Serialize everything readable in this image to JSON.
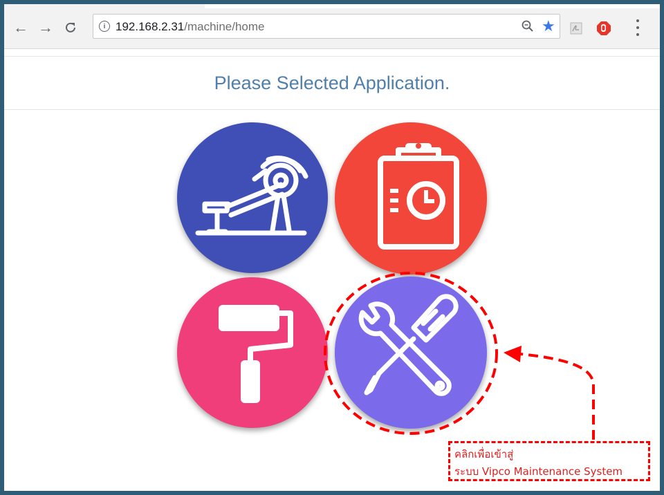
{
  "browser": {
    "url_host": "192.168.2.31",
    "url_path": "/machine/home",
    "colors": {
      "bookmark_star": "#3b78e7",
      "frame": "#2f5d78"
    }
  },
  "page": {
    "title": "Please Selected Application.",
    "title_color": "#4f7fac"
  },
  "apps": [
    {
      "icon": "machine-icon",
      "color": "#3f4fb5"
    },
    {
      "icon": "clipboard-clock-icon",
      "color": "#f2463a"
    },
    {
      "icon": "paint-roller-icon",
      "color": "#ef3e7a"
    },
    {
      "icon": "wrench-screwdriver-icon",
      "color": "#7b6bea"
    }
  ],
  "annotation": {
    "line1": "คลิกเพื่อเข้าสู่",
    "line2": "ระบบ Vipco Maintenance System",
    "color": "#ff0000"
  }
}
